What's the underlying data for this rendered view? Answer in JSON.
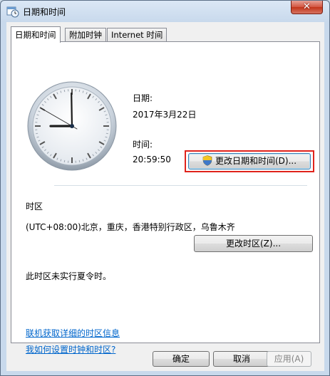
{
  "window": {
    "title": "日期和时间",
    "close_symbol": "✕"
  },
  "tabs": [
    {
      "label": "日期和时间"
    },
    {
      "label": "附加时钟"
    },
    {
      "label": "Internet 时间"
    }
  ],
  "clock": {
    "hour": 20,
    "minute": 59,
    "second": 50
  },
  "datetime": {
    "date_label": "日期:",
    "date_value": "2017年3月22日",
    "time_label": "时间:",
    "time_value": "20:59:50",
    "change_button": "更改日期和时间(D)..."
  },
  "timezone": {
    "section_label": "时区",
    "value": "(UTC+08:00)北京，重庆，香港特别行政区，乌鲁木齐",
    "change_button": "更改时区(Z)...",
    "dst_note": "此时区未实行夏令时。"
  },
  "links": {
    "online_info": "联机获取详细的时区信息",
    "how_to": "我如何设置时钟和时区?"
  },
  "footer": {
    "ok": "确定",
    "cancel": "取消",
    "apply": "应用(A)"
  },
  "colors": {
    "highlight": "#e0231c",
    "link": "#0066cc"
  }
}
